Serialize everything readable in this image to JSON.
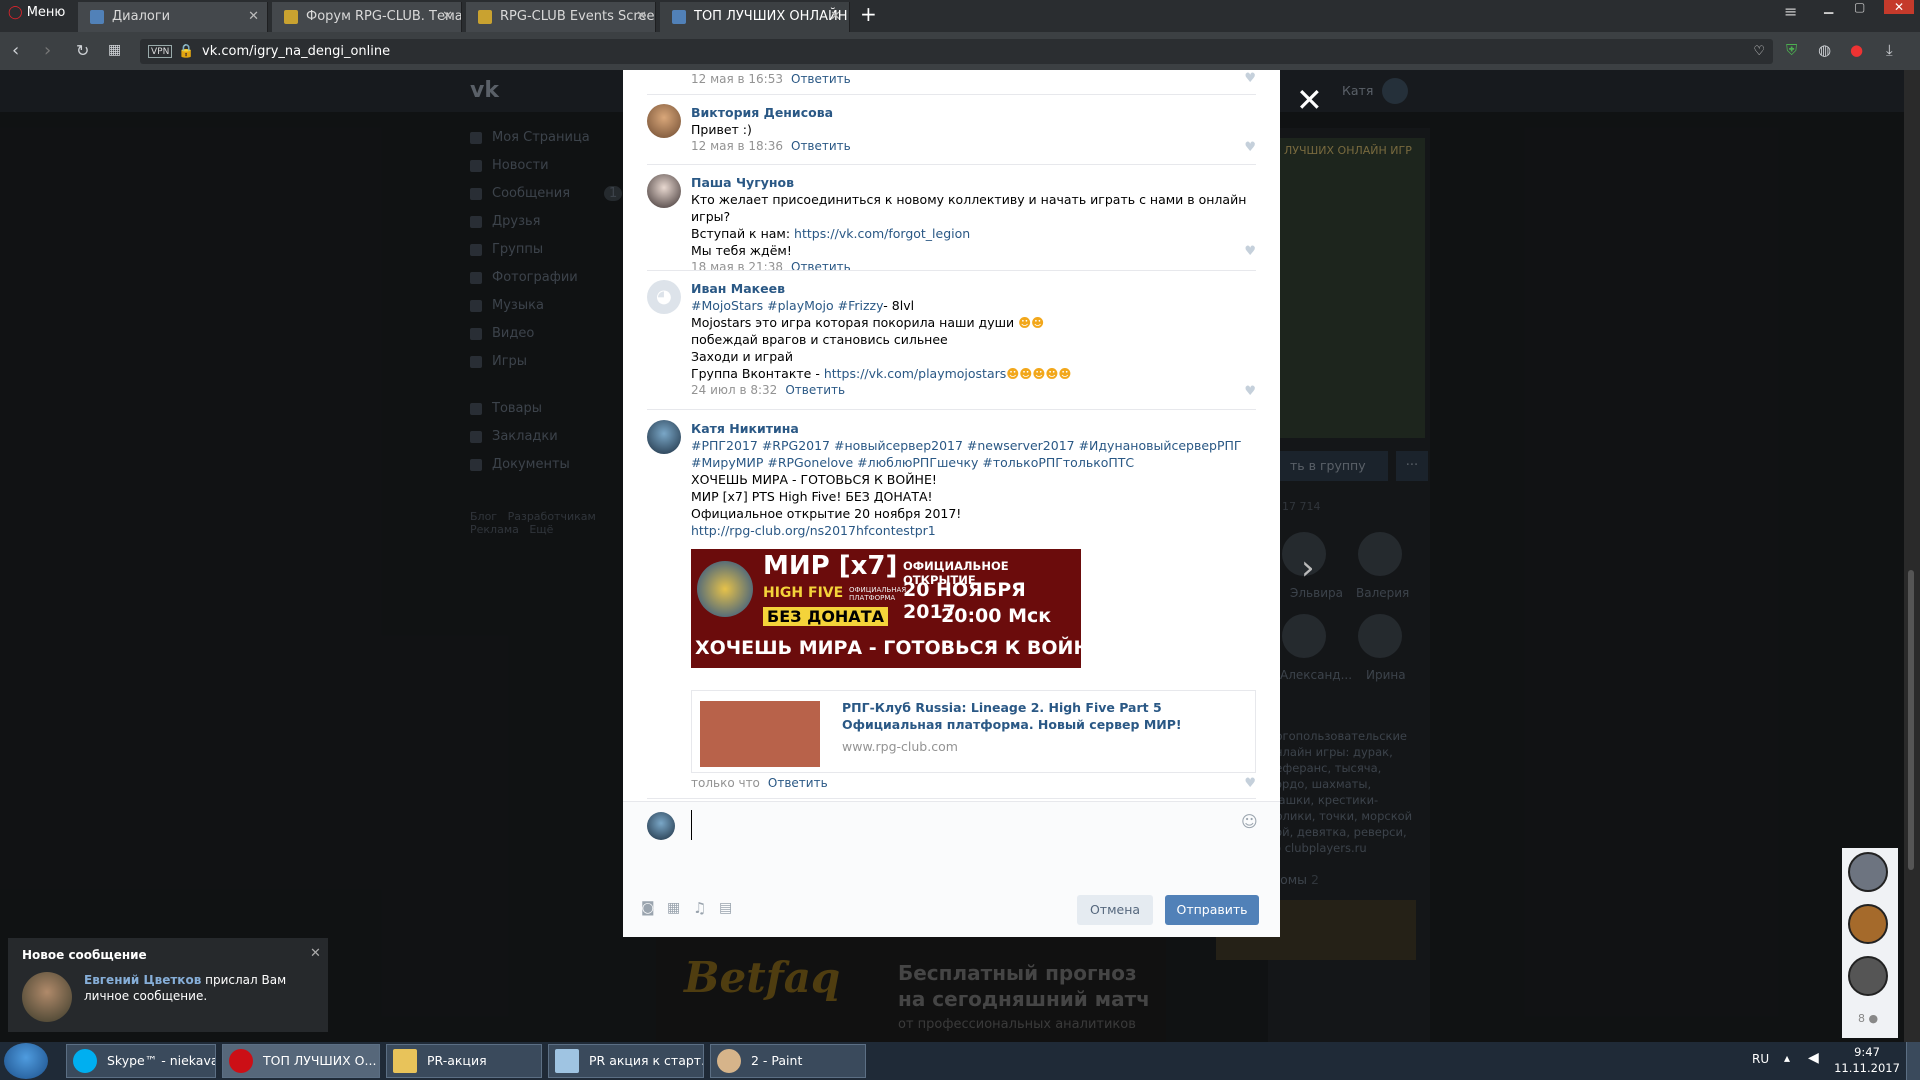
{
  "browser": {
    "menu_label": "Меню",
    "tabs": [
      {
        "label": "Диалоги"
      },
      {
        "label": "Форум RPG-CLUB. Тема: F"
      },
      {
        "label": "RPG-CLUB Events Screenst"
      },
      {
        "label": "ТОП ЛУЧШИХ ОНЛАЙН И"
      }
    ],
    "vpn_badge": "VPN",
    "url": "vk.com/igry_na_dengi_online"
  },
  "vk": {
    "logo": "vk",
    "header_user": "Катя",
    "sidebar": [
      "Моя Страница",
      "Новости",
      "Сообщения",
      "Друзья",
      "Группы",
      "Фотографии",
      "Музыка",
      "Видео",
      "Игры",
      "Товары",
      "Закладки",
      "Документы"
    ],
    "messages_count": "1",
    "footer_links": [
      "Блог",
      "Разработчикам",
      "Реклама",
      "Ещё"
    ],
    "right_banner_text": "ЛУЧШИХ ОНЛАЙН ИГР",
    "join_button": "ть в группу",
    "members_count": "17 714",
    "members": [
      "Эльвира",
      "Валерия",
      "Александ...",
      "Ирина"
    ],
    "description": "ногопользовательские онлайн игры: дурак, реферанс, тысяча, кордо, шахматы, шашки, крестики-нолики, точки, морской бой, девятка, реверси, го clubplayers.ru",
    "photo_albums_label": "Фотоальбомы",
    "photo_albums_count": "2",
    "ad_title": "Бесплатный прогноз",
    "ad_subtitle": "на сегодняшний матч",
    "ad_tail": "от профессиональных аналитиков",
    "online_count": "8"
  },
  "modal": {
    "top_meta": {
      "time": "12 мая в 16:53",
      "reply": "Ответить"
    },
    "comments": [
      {
        "name": "Виктория Денисова",
        "lines": [
          "Привет :)"
        ],
        "time": "12 мая в 18:36",
        "reply": "Ответить"
      },
      {
        "name": "Паша Чугунов",
        "lines": [
          "Кто желает присоединиться к новому коллективу и начать играть с нами в онлайн игры?"
        ],
        "line2_prefix": "Вступай к нам: ",
        "line2_link": "https://vk.com/forgot_legion",
        "line3": "Мы тебя ждём!",
        "time": "18 мая в 21:38",
        "reply": "Ответить"
      },
      {
        "name": "Иван Макеев",
        "tags": "#MojoStars #playMojo #Frizzy",
        "tags_suffix": "- 8lvl",
        "line2": "Mojostars это игра которая покорила наши души",
        "line3": "побеждай врагов и становись сильнее",
        "line4": "Заходи и играй",
        "line5_prefix": "Группа Вконтакте - ",
        "line5_link": "https://vk.com/playmojostars",
        "time": "24 июл в 8:32",
        "reply": "Ответить"
      },
      {
        "name": "Катя Никитина",
        "tags1": "#РПГ2017 #RPG2017 #новыйсервер2017 #newserver2017 #ИдунановыйсерверРПГ",
        "tags2": "#МируМИР #RPGonelove #любл​юРПГшечку #толькоРПГтолькоПТС",
        "line3": "ХОЧЕШЬ МИРА - ГОТОВЬСЯ К ВОЙНЕ!",
        "line4": "МИР [x7] PTS High Five! БЕЗ ДОНАТА!",
        "line5": "Официальное открытие 20 ноября 2017!",
        "link": "http://rpg-club.org/ns2017hfcontestpr1",
        "time": "только что",
        "reply": "Ответить"
      }
    ],
    "banner": {
      "brand": "МИР [x7]",
      "subbrand": "HIGH FIVE",
      "platform": "ОФИЦИАЛЬНАЯ ПЛАТФОРМА",
      "nodonate": "БЕЗ ДОНАТА",
      "opening": "ОФИЦИАЛЬНОЕ ОТКРЫТИЕ",
      "date": "20 НОЯБРЯ 2017",
      "time": "20:00 Мск",
      "slogan": "ХОЧЕШЬ МИРА - ГОТОВЬСЯ К ВОЙНЕ"
    },
    "snippet": {
      "title": "РПГ-Клуб Russia: Lineage 2. High Five Part 5 Официальная платформа. Новый сервер МИР!",
      "domain": "www.rpg-club.com"
    },
    "cancel_label": "Отмена",
    "send_label": "Отправить"
  },
  "notification": {
    "title": "Новое сообщение",
    "sender": "Евгений Цветков",
    "text": " прислал Вам личное сообщение."
  },
  "taskbar": {
    "items": [
      {
        "label": "Skype™ - niekava"
      },
      {
        "label": "ТОП ЛУЧШИХ О..."
      },
      {
        "label": "PR-акция"
      },
      {
        "label": "PR акция к старт..."
      },
      {
        "label": "2 - Paint"
      }
    ],
    "lang": "RU",
    "time": "9:47",
    "date": "11.11.2017"
  }
}
